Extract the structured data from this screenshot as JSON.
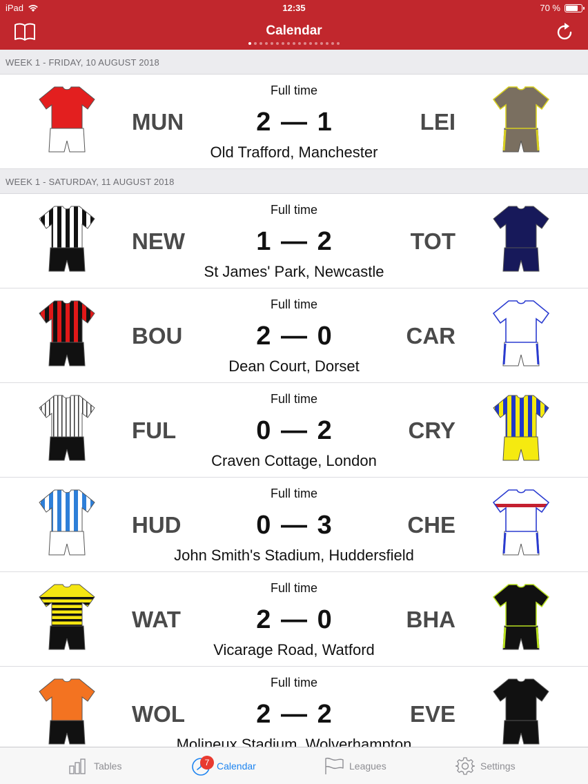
{
  "status_bar": {
    "device": "iPad",
    "time": "12:35",
    "battery": "70 %"
  },
  "nav": {
    "title": "Calendar",
    "left_icon": "book-icon",
    "right_icon": "refresh-icon",
    "page_count": 17,
    "active_page": 0
  },
  "sections": [
    {
      "header": "WEEK 1 - FRIDAY, 10 AUGUST 2018",
      "matches": [
        {
          "status": "Full time",
          "home": "MUN",
          "away": "LEI",
          "home_score": "2",
          "away_score": "1",
          "venue": "Old Trafford, Manchester",
          "home_kit": {
            "shirt": "#e31f1f",
            "shorts": "#ffffff",
            "pattern": "plain"
          },
          "away_kit": {
            "shirt": "#7a6f60",
            "shorts": "#7a6f60",
            "pattern": "plain",
            "trim": "#d8d020"
          }
        }
      ]
    },
    {
      "header": "WEEK 1 - SATURDAY, 11 AUGUST 2018",
      "matches": [
        {
          "status": "Full time",
          "home": "NEW",
          "away": "TOT",
          "home_score": "1",
          "away_score": "2",
          "venue": "St James' Park, Newcastle",
          "home_kit": {
            "shirt": "#ffffff",
            "shorts": "#111111",
            "pattern": "stripes",
            "stripe": "#111111"
          },
          "away_kit": {
            "shirt": "#17195a",
            "shorts": "#17195a",
            "pattern": "plain"
          }
        },
        {
          "status": "Full time",
          "home": "BOU",
          "away": "CAR",
          "home_score": "2",
          "away_score": "0",
          "venue": "Dean Court, Dorset",
          "home_kit": {
            "shirt": "#111111",
            "shorts": "#111111",
            "pattern": "stripes",
            "stripe": "#e01818"
          },
          "away_kit": {
            "shirt": "#ffffff",
            "shorts": "#ffffff",
            "pattern": "plain",
            "trim": "#2a3bd0"
          }
        },
        {
          "status": "Full time",
          "home": "FUL",
          "away": "CRY",
          "home_score": "0",
          "away_score": "2",
          "venue": "Craven Cottage, London",
          "home_kit": {
            "shirt": "#ffffff",
            "shorts": "#111111",
            "pattern": "pinstripes",
            "stripe": "#333333"
          },
          "away_kit": {
            "shirt": "#f5ea10",
            "shorts": "#f5ea10",
            "pattern": "stripes",
            "stripe": "#2038c8"
          }
        },
        {
          "status": "Full time",
          "home": "HUD",
          "away": "CHE",
          "home_score": "0",
          "away_score": "3",
          "venue": "John Smith's Stadium, Huddersfield",
          "home_kit": {
            "shirt": "#ffffff",
            "shorts": "#ffffff",
            "pattern": "stripes",
            "stripe": "#2e7fd8"
          },
          "away_kit": {
            "shirt": "#ffffff",
            "shorts": "#ffffff",
            "pattern": "band",
            "stripe": "#c42030",
            "trim": "#2a3bd0"
          }
        },
        {
          "status": "Full time",
          "home": "WAT",
          "away": "BHA",
          "home_score": "2",
          "away_score": "0",
          "venue": "Vicarage Road, Watford",
          "home_kit": {
            "shirt": "#f5e612",
            "shorts": "#111111",
            "pattern": "hoops",
            "stripe": "#111111"
          },
          "away_kit": {
            "shirt": "#111111",
            "shorts": "#111111",
            "pattern": "plain",
            "trim": "#b8e020"
          }
        },
        {
          "status": "Full time",
          "home": "WOL",
          "away": "EVE",
          "home_score": "2",
          "away_score": "2",
          "venue": "Molineux Stadium, Wolverhampton",
          "home_kit": {
            "shirt": "#f37321",
            "shorts": "#111111",
            "pattern": "plain"
          },
          "away_kit": {
            "shirt": "#111111",
            "shorts": "#111111",
            "pattern": "plain"
          }
        }
      ]
    }
  ],
  "tabbar": {
    "tabs": [
      {
        "label": "Tables",
        "icon": "bar-chart-icon",
        "active": false
      },
      {
        "label": "Calendar",
        "icon": "clock-icon",
        "active": true,
        "badge": "7"
      },
      {
        "label": "Leagues",
        "icon": "flag-icon",
        "active": false
      },
      {
        "label": "Settings",
        "icon": "gear-icon",
        "active": false
      }
    ]
  }
}
